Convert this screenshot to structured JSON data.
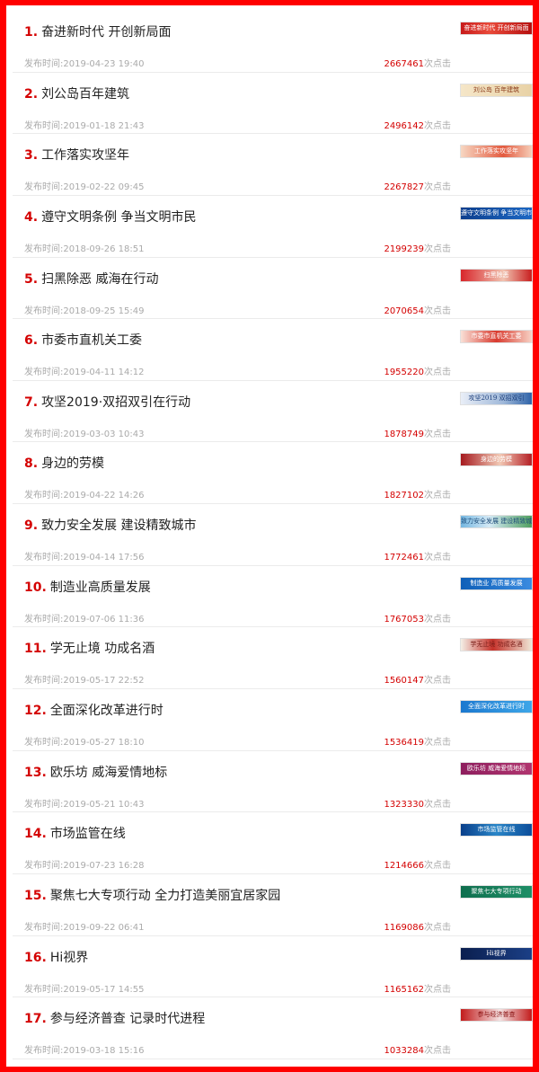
{
  "list": {
    "time_prefix": "发布时间:",
    "click_suffix": "次点击",
    "items": [
      {
        "num": "1.",
        "title": "奋进新时代 开创新局面",
        "time": "2019-04-23 19:40",
        "clicks": "2667461",
        "thumb": "奋进新时代 开创新局面"
      },
      {
        "num": "2.",
        "title": "刘公岛百年建筑",
        "time": "2019-01-18 21:43",
        "clicks": "2496142",
        "thumb": "刘公岛 百年建筑"
      },
      {
        "num": "3.",
        "title": "工作落实攻坚年",
        "time": "2019-02-22 09:45",
        "clicks": "2267827",
        "thumb": "工作落实攻坚年"
      },
      {
        "num": "4.",
        "title": "遵守文明条例 争当文明市民",
        "time": "2018-09-26 18:51",
        "clicks": "2199239",
        "thumb": "遵守文明条例 争当文明市民"
      },
      {
        "num": "5.",
        "title": "扫黑除恶 威海在行动",
        "time": "2018-09-25 15:49",
        "clicks": "2070654",
        "thumb": "扫黑除恶"
      },
      {
        "num": "6.",
        "title": "市委市直机关工委",
        "time": "2019-04-11 14:12",
        "clicks": "1955220",
        "thumb": "市委市直机关工委"
      },
      {
        "num": "7.",
        "title": "攻坚2019·双招双引在行动",
        "time": "2019-03-03 10:43",
        "clicks": "1878749",
        "thumb": "攻坚2019 双招双引"
      },
      {
        "num": "8.",
        "title": "身边的劳模",
        "time": "2019-04-22 14:26",
        "clicks": "1827102",
        "thumb": "身边的劳模"
      },
      {
        "num": "9.",
        "title": "致力安全发展 建设精致城市",
        "time": "2019-04-14 17:56",
        "clicks": "1772461",
        "thumb": "致力安全发展 建设精致城市"
      },
      {
        "num": "10.",
        "title": "制造业高质量发展",
        "time": "2019-07-06 11:36",
        "clicks": "1767053",
        "thumb": "制造业 高质量发展"
      },
      {
        "num": "11.",
        "title": "学无止境 功成名酒",
        "time": "2019-05-17 22:52",
        "clicks": "1560147",
        "thumb": "学无止境 功成名酒"
      },
      {
        "num": "12.",
        "title": "全面深化改革进行时",
        "time": "2019-05-27 18:10",
        "clicks": "1536419",
        "thumb": "全面深化改革进行时"
      },
      {
        "num": "13.",
        "title": "欧乐坊 威海爱情地标",
        "time": "2019-05-21 10:43",
        "clicks": "1323330",
        "thumb": "欧乐坊 威海爱情地标"
      },
      {
        "num": "14.",
        "title": "市场监管在线",
        "time": "2019-07-23 16:28",
        "clicks": "1214666",
        "thumb": "市场监管在线"
      },
      {
        "num": "15.",
        "title": "聚焦七大专项行动 全力打造美丽宜居家园",
        "time": "2019-09-22 06:41",
        "clicks": "1169086",
        "thumb": "聚焦七大专项行动"
      },
      {
        "num": "16.",
        "title": "Hi视界",
        "time": "2019-05-17 14:55",
        "clicks": "1165162",
        "thumb": "Hi视界"
      },
      {
        "num": "17.",
        "title": "参与经济普查 记录时代进程",
        "time": "2019-03-18 15:16",
        "clicks": "1033284",
        "thumb": "参与经济普查"
      }
    ]
  }
}
